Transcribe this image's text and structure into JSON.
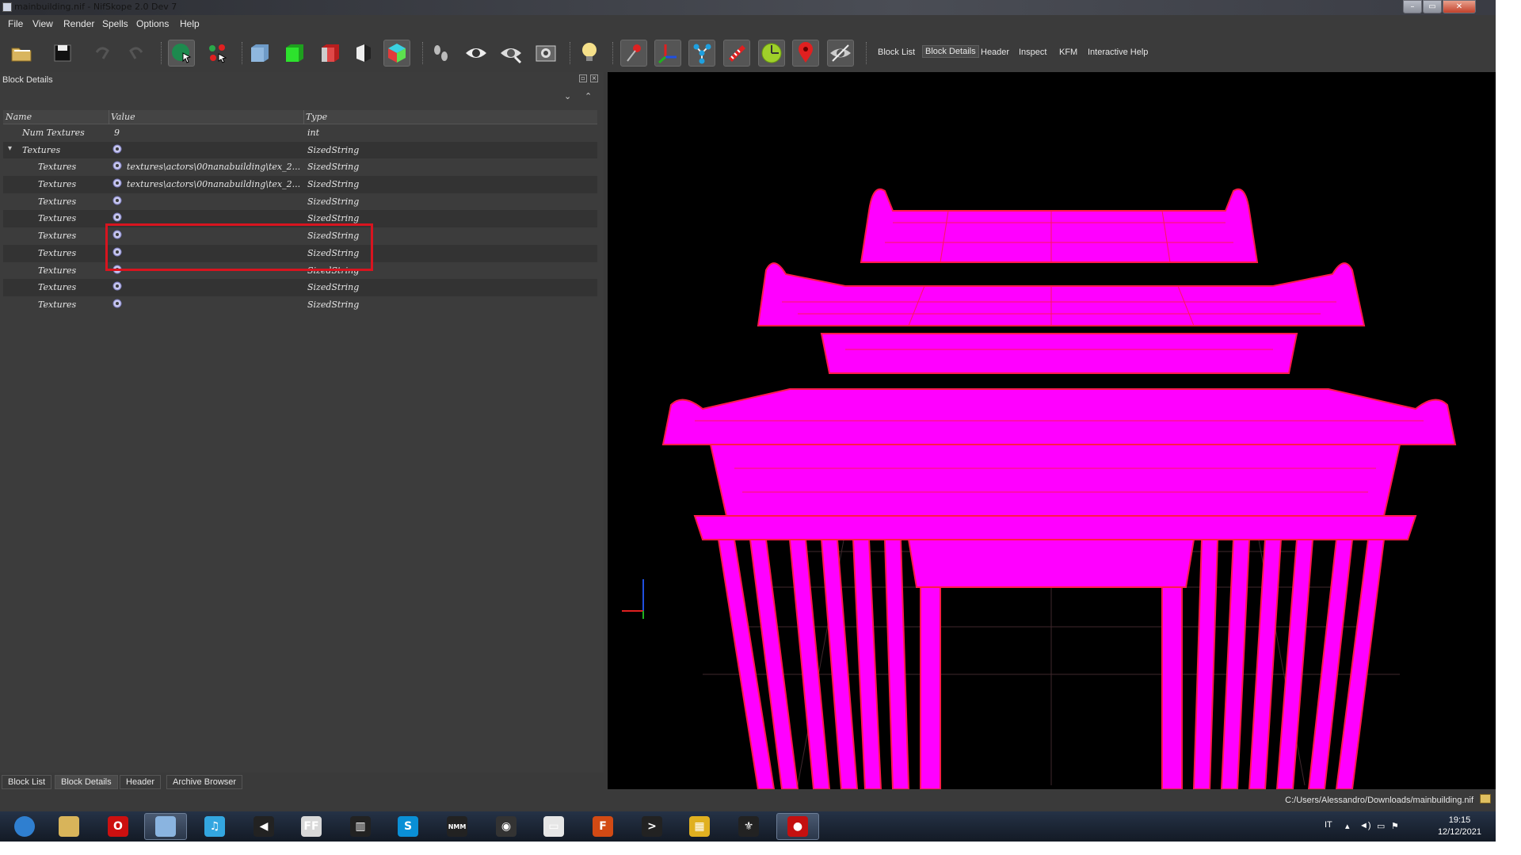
{
  "window": {
    "title": "mainbuilding.nif - NifSkope 2.0 Dev 7",
    "controls": [
      "minimize",
      "maximize",
      "close"
    ]
  },
  "menu": [
    "File",
    "View",
    "Render",
    "Spells",
    "Options",
    "Help"
  ],
  "toolbar": {
    "icons": [
      "load-icon",
      "save-icon",
      "undo-icon",
      "redo-icon",
      "select-object-icon",
      "select-vertex-icon",
      "textures-icon",
      "vertex-colors-icon",
      "normals-icon",
      "specular-icon",
      "glow-icon",
      "lighting-icon",
      "eye-icon",
      "hidden-icon",
      "screenshot-icon",
      "light-bulb-icon",
      "pin-icon",
      "axes-icon",
      "nodes-icon",
      "constraints-icon",
      "furniture-icon",
      "marker-icon",
      "hide-icon"
    ],
    "tabs": [
      {
        "label": "Block List",
        "active": false
      },
      {
        "label": "Block Details",
        "active": true
      },
      {
        "label": "Header",
        "active": false
      },
      {
        "label": "Inspect",
        "active": false
      },
      {
        "label": "KFM",
        "active": false
      },
      {
        "label": "Interactive Help",
        "active": false
      }
    ]
  },
  "panel": {
    "title": "Block Details",
    "columns": {
      "name": "Name",
      "value": "Value",
      "type": "Type"
    },
    "rows": [
      {
        "name": "Num Textures",
        "value": "9",
        "type": "int",
        "indent": 1,
        "icon": false
      },
      {
        "name": "Textures",
        "value": "",
        "type": "SizedString",
        "indent": 1,
        "icon": true,
        "expander": "▾"
      },
      {
        "name": "Textures",
        "value": "textures\\actors\\00nanabuilding\\tex_2...",
        "type": "SizedString",
        "indent": 2,
        "icon": true
      },
      {
        "name": "Textures",
        "value": "textures\\actors\\00nanabuilding\\tex_2...",
        "type": "SizedString",
        "indent": 2,
        "icon": true
      },
      {
        "name": "Textures",
        "value": "",
        "type": "SizedString",
        "indent": 2,
        "icon": true
      },
      {
        "name": "Textures",
        "value": "",
        "type": "SizedString",
        "indent": 2,
        "icon": true
      },
      {
        "name": "Textures",
        "value": "",
        "type": "SizedString",
        "indent": 2,
        "icon": true
      },
      {
        "name": "Textures",
        "value": "",
        "type": "SizedString",
        "indent": 2,
        "icon": true
      },
      {
        "name": "Textures",
        "value": "",
        "type": "SizedString",
        "indent": 2,
        "icon": true
      },
      {
        "name": "Textures",
        "value": "",
        "type": "SizedString",
        "indent": 2,
        "icon": true
      },
      {
        "name": "Textures",
        "value": "",
        "type": "SizedString",
        "indent": 2,
        "icon": true
      }
    ]
  },
  "bottom_tabs": [
    {
      "label": "Block List",
      "active": false
    },
    {
      "label": "Block Details",
      "active": true
    },
    {
      "label": "Header",
      "active": false
    },
    {
      "label": "Archive Browser",
      "active": false
    }
  ],
  "status": {
    "path": "C:/Users/Alessandro/Downloads/mainbuilding.nif"
  },
  "viewport": {
    "model_color": "#ff00ff",
    "wire_color": "#ff1a4a"
  },
  "taskbar": {
    "apps": [
      {
        "name": "start-orb-icon",
        "glyph": "",
        "color": "#2f7fd0"
      },
      {
        "name": "explorer-icon",
        "glyph": "",
        "color": "#d8b45a"
      },
      {
        "name": "opera-icon",
        "glyph": "O",
        "color": "#cc1010"
      },
      {
        "name": "virtualbox-icon",
        "glyph": "",
        "color": "#8ab4e0"
      },
      {
        "name": "itunes-icon",
        "glyph": "♫",
        "color": "#33a6e0"
      },
      {
        "name": "volume-app-icon",
        "glyph": "◀",
        "color": "#222"
      },
      {
        "name": "ffdec-icon",
        "glyph": "FF",
        "color": "#d8d8d8"
      },
      {
        "name": "grid-app-icon",
        "glyph": "▥",
        "color": "#222"
      },
      {
        "name": "skype-icon",
        "glyph": "S",
        "color": "#0a8fd6"
      },
      {
        "name": "nmm-icon",
        "glyph": "NMM",
        "color": "#222"
      },
      {
        "name": "camera-app-icon",
        "glyph": "◉",
        "color": "#333"
      },
      {
        "name": "window-app-icon",
        "glyph": "▭",
        "color": "#e6e6e6"
      },
      {
        "name": "f-app-icon",
        "glyph": "F",
        "color": "#d24a14"
      },
      {
        "name": "bracket-app-icon",
        "glyph": ">",
        "color": "#222"
      },
      {
        "name": "calendar-app-icon",
        "glyph": "▦",
        "color": "#e0b020"
      },
      {
        "name": "skyrim-icon",
        "glyph": "⚜",
        "color": "#222"
      },
      {
        "name": "record-app-icon",
        "glyph": "●",
        "color": "#c41010"
      }
    ],
    "lang": "IT",
    "time": "19:15",
    "date": "12/12/2021"
  }
}
